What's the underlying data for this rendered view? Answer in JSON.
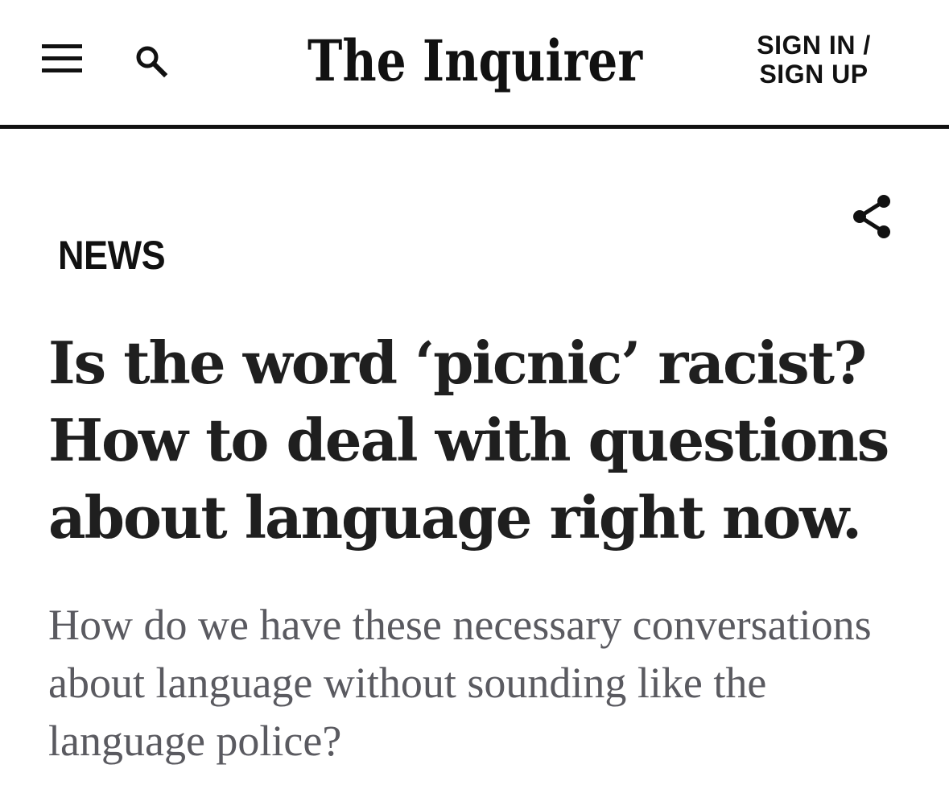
{
  "header": {
    "logo_text": "The Inquirer",
    "signin_line1": "SIGN IN /",
    "signin_line2": "SIGN UP",
    "icons": {
      "menu": "hamburger-menu-icon",
      "search": "search-icon",
      "share": "share-icon"
    }
  },
  "article": {
    "section": "NEWS",
    "headline": "Is the word ‘picnic’ racist? How to deal with questions about language right now.",
    "subheadline": "How do we have these necessary conversations about language without sounding like the language police?"
  },
  "colors": {
    "headline": "#1f1f1f",
    "subheadline": "#5a5a60",
    "rule": "#111111"
  }
}
